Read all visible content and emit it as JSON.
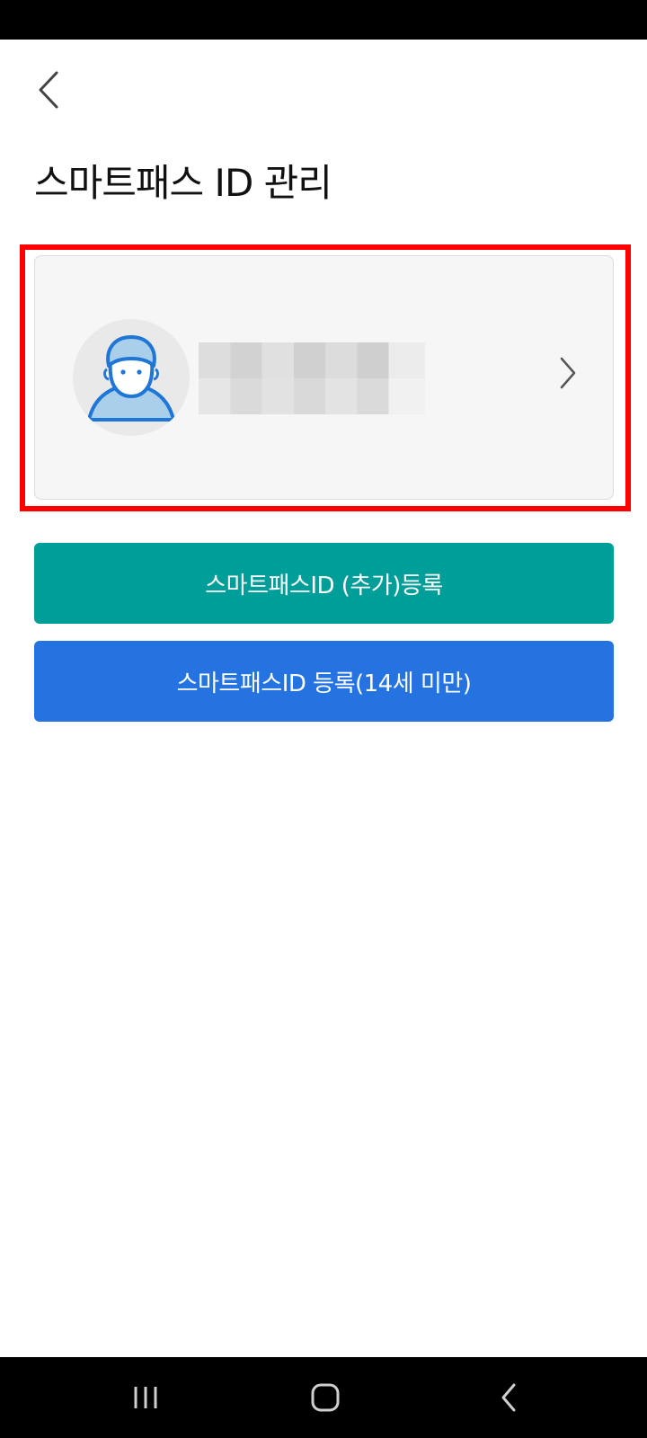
{
  "header": {
    "title": "스마트패스 ID 관리",
    "back_icon": "chevron-left-icon"
  },
  "account_card": {
    "avatar_icon": "user-avatar-icon",
    "name": "",
    "chevron_icon": "chevron-right-icon"
  },
  "buttons": {
    "add_label": "스마트패스ID (추가)등록",
    "minor_label": "스마트패스ID 등록(14세 미만)"
  },
  "colors": {
    "highlight": "#ff0000",
    "add_button": "#009e99",
    "minor_button": "#2473e0",
    "avatar_fill": "#a9cfea",
    "avatar_stroke": "#1f76d6"
  },
  "nav": {
    "recents_icon": "recents-icon",
    "home_icon": "home-icon",
    "back_icon": "back-icon"
  }
}
